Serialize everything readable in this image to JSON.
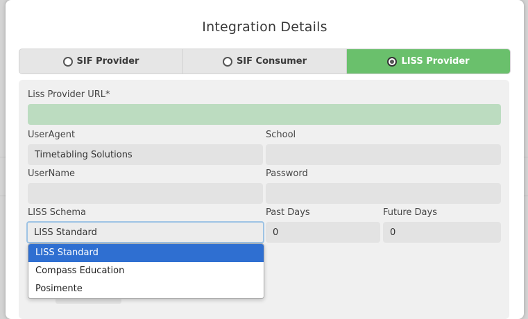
{
  "dialog": {
    "title": "Integration Details"
  },
  "tabs": [
    {
      "label": "SIF Provider",
      "selected": false
    },
    {
      "label": "SIF Consumer",
      "selected": false
    },
    {
      "label": "LISS Provider",
      "selected": true
    }
  ],
  "form": {
    "liss_url": {
      "label": "Liss Provider URL*",
      "value": ""
    },
    "user_agent": {
      "label": "UserAgent",
      "value": "Timetabling Solutions"
    },
    "school": {
      "label": "School",
      "value": ""
    },
    "username": {
      "label": "UserName",
      "value": ""
    },
    "password": {
      "label": "Password",
      "value": ""
    },
    "liss_schema": {
      "label": "LISS Schema",
      "value": "LISS Standard",
      "options": [
        "LISS Standard",
        "Compass Education",
        "Posimente"
      ]
    },
    "past_days": {
      "label": "Past Days",
      "value": "0"
    },
    "future_days": {
      "label": "Future Days",
      "value": "0"
    }
  },
  "colors": {
    "active_tab": "#6ac06c",
    "url_field": "#bcdcc0",
    "selected_option": "#2f6fd1",
    "focus_border": "#9ec3e4"
  }
}
